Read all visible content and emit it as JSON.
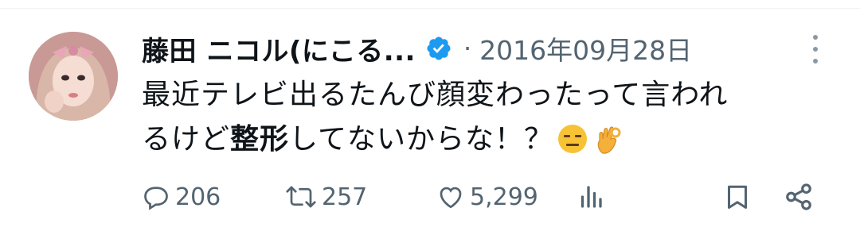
{
  "tweet": {
    "author": {
      "display_name": "藤田 ニコル(にこる...",
      "verified_icon": "verified-badge-icon"
    },
    "separator": "·",
    "date": "2016年09月28日",
    "text": {
      "line1": "最近テレビ出るたんび顔変わったって言われ",
      "line2_before": "るけど",
      "line2_bold": "整形",
      "line2_after": "してないからな！？",
      "emojis": [
        "expressionless-face-emoji",
        "ok-hand-emoji"
      ]
    },
    "actions": {
      "reply_count": "206",
      "retweet_count": "257",
      "like_count": "5,299",
      "icons": [
        "reply-icon",
        "retweet-icon",
        "like-icon",
        "analytics-icon",
        "bookmark-icon",
        "share-icon"
      ]
    }
  },
  "colors": {
    "text_primary": "#0f1419",
    "text_secondary": "#536471",
    "verified_blue": "#1d9bf0",
    "divider": "#eff3f4"
  }
}
